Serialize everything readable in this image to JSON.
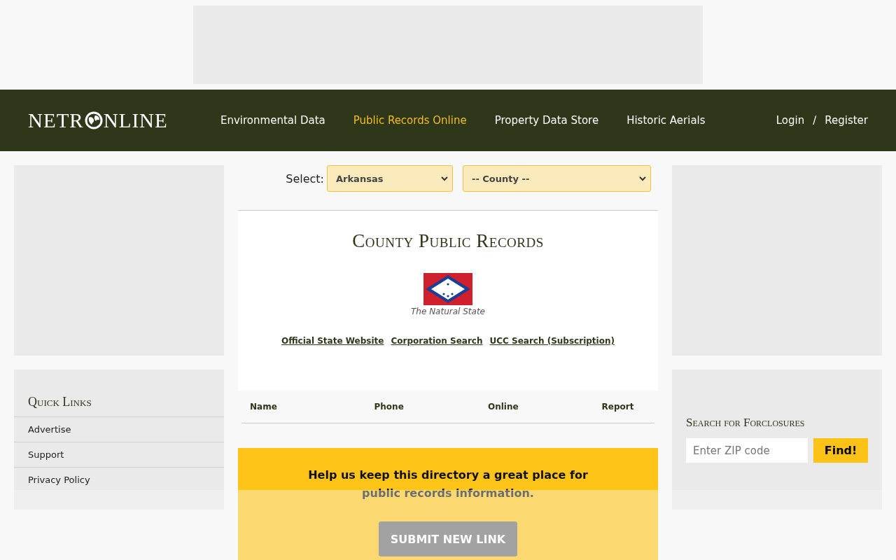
{
  "header": {
    "logo": {
      "before": "NETR",
      "after": "NLINE"
    },
    "nav": [
      {
        "label": "Environmental Data",
        "selected": false
      },
      {
        "label": "Public Records Online",
        "selected": true
      },
      {
        "label": "Property Data Store",
        "selected": false
      },
      {
        "label": "Historic Aerials",
        "selected": false
      }
    ],
    "account": {
      "login": "Login",
      "separator": "/",
      "register": "Register"
    }
  },
  "quick_links": {
    "title": "Quick Links",
    "items": [
      "Advertise",
      "Support",
      "Privacy Policy"
    ]
  },
  "selector": {
    "label": "Select:",
    "state": "Arkansas",
    "county": "-- County --"
  },
  "card": {
    "title": "County Public Records",
    "motto": "The Natural State",
    "links": [
      "Official State Website",
      "Corporation Search",
      "UCC Search (Subscription)"
    ]
  },
  "table": {
    "columns": [
      "Name",
      "Phone",
      "Online",
      "Report"
    ]
  },
  "help_box": {
    "text": "Help us keep this directory a great place for public records information.",
    "button": "SUBMIT NEW LINK"
  },
  "foreclosure_search": {
    "title": "Search for Forclosures",
    "placeholder": "Enter ZIP code",
    "button": "Find!"
  }
}
